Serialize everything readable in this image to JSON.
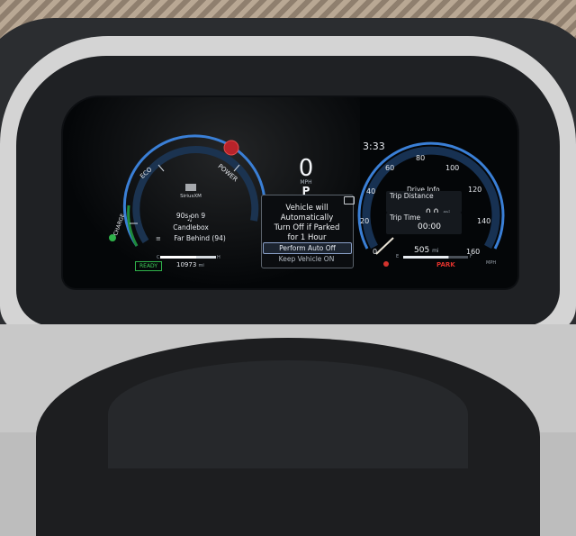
{
  "power_meter": {
    "labels": {
      "eco": "ECO",
      "power": "POWER",
      "charge": "CHARGE"
    },
    "status": "READY",
    "odometer": "10973",
    "odometer_unit": "mi",
    "charge_scale": {
      "low": "C",
      "high": "H"
    }
  },
  "audio": {
    "source": "SiriusXM",
    "channel": "90s on 9",
    "artist": "Candlebox",
    "song": "Far Behind (94)"
  },
  "center": {
    "speed": "0",
    "speed_unit": "MPH",
    "gear": "P"
  },
  "clock": "3:33",
  "dialog": {
    "line1": "Vehicle will",
    "line2": "Automatically",
    "line3": "Turn Off if Parked",
    "line4": "for 1 Hour",
    "primary_button": "Perform Auto Off",
    "secondary_button": "Keep Vehicle ON"
  },
  "speedometer": {
    "ticks": [
      "0",
      "20",
      "40",
      "60",
      "80",
      "100",
      "120",
      "140",
      "160"
    ],
    "unit": "MPH",
    "current_speed": 0
  },
  "drive_info": {
    "title": "Drive Info",
    "trip_distance_label": "Trip Distance",
    "trip_distance_value": "0.0",
    "trip_distance_unit": "mi",
    "trip_time_label": "Trip Time",
    "trip_time_value": "00:00"
  },
  "fuel": {
    "range_value": "505",
    "range_unit": "mi",
    "empty_label": "E",
    "full_label": "F",
    "level": 0.7
  },
  "park_indicator": "PARK",
  "colors": {
    "arc_blue": "#3a7fd6",
    "ready_green": "#3fd05a",
    "park_red": "#e0322c",
    "brake_warning_red": "#d22a2a"
  }
}
